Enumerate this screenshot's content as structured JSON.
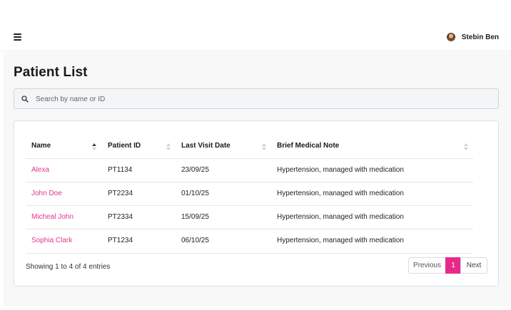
{
  "header": {
    "user_name": "Stebin Ben"
  },
  "page": {
    "title": "Patient List"
  },
  "search": {
    "placeholder": "Search by name or ID"
  },
  "table": {
    "columns": [
      {
        "label": "Name",
        "sort": "asc"
      },
      {
        "label": "Patient ID",
        "sort": "none"
      },
      {
        "label": "Last Visit Date",
        "sort": "none"
      },
      {
        "label": "Brief Medical Note",
        "sort": "none"
      }
    ],
    "rows": [
      {
        "name": "Alexa",
        "id": "PT1134",
        "date": "23/09/25",
        "note": "Hypertension, managed with medication"
      },
      {
        "name": "John Doe",
        "id": "PT2234",
        "date": "01/10/25",
        "note": "Hypertension, managed with medication"
      },
      {
        "name": "Micheal John",
        "id": "PT2334",
        "date": "15/09/25",
        "note": "Hypertension, managed with medication"
      },
      {
        "name": "Sophia Clark",
        "id": "PT1234",
        "date": "06/10/25",
        "note": "Hypertension, managed with medication"
      }
    ]
  },
  "footer": {
    "entries_info": "Showing 1 to 4 of 4 entries",
    "prev_label": "Previous",
    "current_page": "1",
    "next_label": "Next"
  },
  "colors": {
    "accent": "#e8298a",
    "link": "#e0358f"
  }
}
